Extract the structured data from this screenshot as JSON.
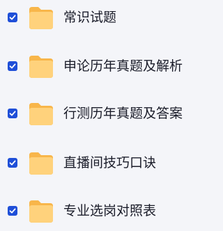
{
  "colors": {
    "checkbox": "#1f4fd8",
    "folder_body": "#ffd27c",
    "folder_back": "#f8b64a",
    "text": "#1b1d2a",
    "background": "#f4f5f9"
  },
  "items": [
    {
      "label": "常识试题",
      "checked": true,
      "icon": "folder-icon"
    },
    {
      "label": "申论历年真题及解析",
      "checked": true,
      "icon": "folder-icon"
    },
    {
      "label": "行测历年真题及答案",
      "checked": true,
      "icon": "folder-icon"
    },
    {
      "label": "直播间技巧口诀",
      "checked": true,
      "icon": "folder-icon"
    },
    {
      "label": "专业选岗对照表",
      "checked": true,
      "icon": "folder-icon"
    }
  ]
}
